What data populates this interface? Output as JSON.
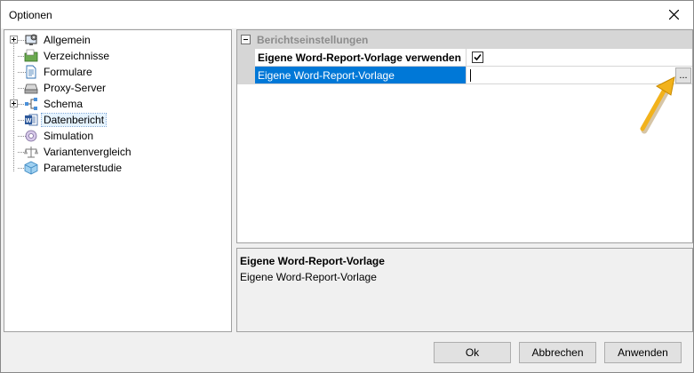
{
  "window": {
    "title": "Optionen"
  },
  "tree": {
    "items": [
      {
        "label": "Allgemein",
        "icon": "gear-monitor-icon",
        "expandable": true
      },
      {
        "label": "Verzeichnisse",
        "icon": "folder-icon",
        "expandable": false
      },
      {
        "label": "Formulare",
        "icon": "document-icon",
        "expandable": false
      },
      {
        "label": "Proxy-Server",
        "icon": "server-icon",
        "expandable": false
      },
      {
        "label": "Schema",
        "icon": "schema-icon",
        "expandable": true
      },
      {
        "label": "Datenbericht",
        "icon": "word-icon",
        "expandable": false,
        "selected": true
      },
      {
        "label": "Simulation",
        "icon": "simulation-icon",
        "expandable": false
      },
      {
        "label": "Variantenvergleich",
        "icon": "scale-icon",
        "expandable": false
      },
      {
        "label": "Parameterstudie",
        "icon": "cube-icon",
        "expandable": false
      }
    ]
  },
  "grid": {
    "category": "Berichtseinstellungen",
    "rows": [
      {
        "name": "Eigene Word-Report-Vorlage verwenden",
        "value": "",
        "checked": true
      },
      {
        "name": "Eigene Word-Report-Vorlage",
        "value": "",
        "button": "..."
      }
    ]
  },
  "description": {
    "title": "Eigene Word-Report-Vorlage",
    "text": "Eigene Word-Report-Vorlage"
  },
  "buttons": {
    "ok": "Ok",
    "cancel": "Abbrechen",
    "apply": "Anwenden"
  },
  "colors": {
    "selection": "#0078d7",
    "arrow": "#f2b21b"
  }
}
